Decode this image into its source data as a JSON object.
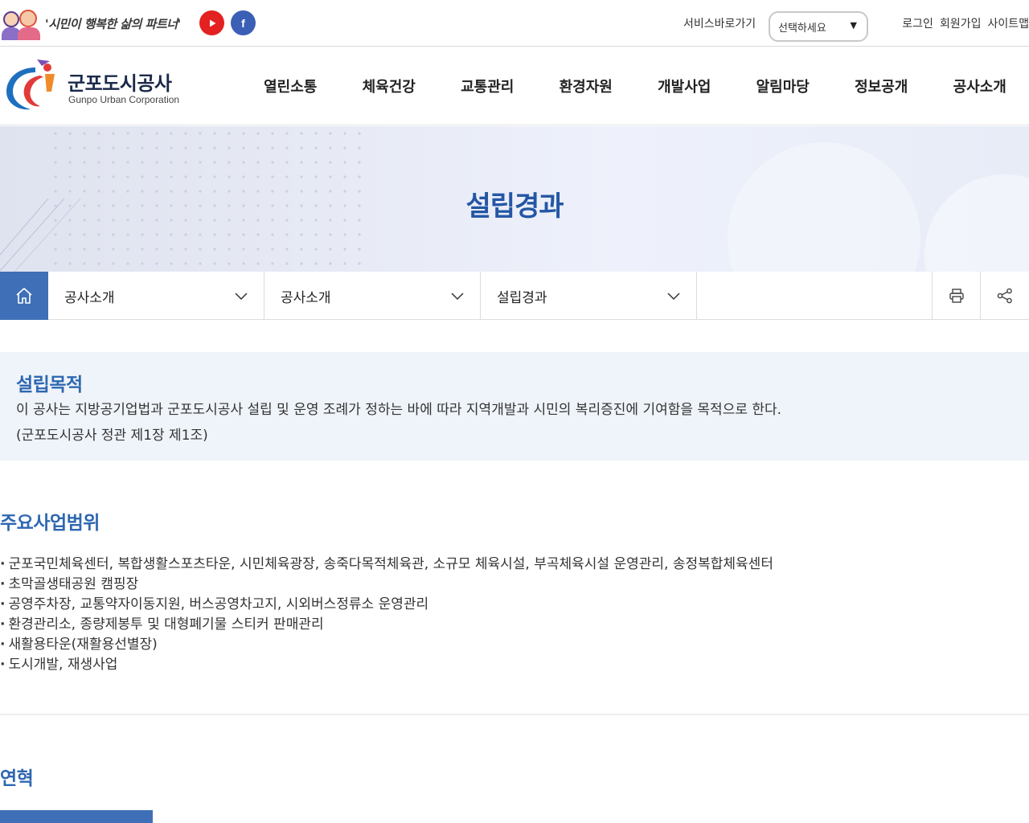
{
  "topbar": {
    "slogan": "'시민이 행복한 삶의 파트너'",
    "sns": {
      "youtube_icon": "youtube-icon",
      "facebook_icon": "facebook-icon",
      "facebook_glyph": "f"
    },
    "shortcut_label": "서비스바로가기",
    "shortcut_select": {
      "selected": "선택하세요"
    },
    "links": [
      "로그인",
      "회원가입",
      "사이트맵"
    ]
  },
  "header": {
    "logo_name": "군포도시공사",
    "logo_sub": "Gunpo Urban Corporation",
    "gnb": [
      "열린소통",
      "체육건강",
      "교통관리",
      "환경자원",
      "개발사업",
      "알림마당",
      "정보공개",
      "공사소개"
    ]
  },
  "visual": {
    "title": "설립경과"
  },
  "location": {
    "home_icon": "home-icon",
    "crumbs": [
      "공사소개",
      "공사소개",
      "설립경과"
    ],
    "print_icon": "print-icon",
    "share_icon": "share-icon"
  },
  "purpose": {
    "title": "설립목적",
    "text": "이 공사는 지방공기업법과 군포도시공사 설립 및 운영 조례가 정하는 바에 따라 지역개발과 시민의 복리증진에 기여함을 목적으로 한다.",
    "source": "(군포도시공사 정관 제1장 제1조)"
  },
  "business": {
    "title": "주요사업범위",
    "items": [
      "군포국민체육센터, 복합생활스포츠타운, 시민체육광장, 송죽다목적체육관, 소규모 체육시설, 부곡체육시설 운영관리, 송정복합체육센터",
      "초막골생태공원 캠핑장",
      "공영주차장, 교통약자이동지원, 버스공영차고지, 시외버스정류소 운영관리",
      "환경관리소, 종량제봉투 및 대형폐기물 스티커 판매관리",
      "새활용타운(재활용선별장)",
      "도시개발, 재생사업"
    ]
  },
  "history": {
    "title": "연혁"
  },
  "colors": {
    "primary": "#3f6fb7",
    "heading": "#2e67b1",
    "visual_title": "#2456a4",
    "youtube": "#e32121",
    "facebook": "#3b5fb5"
  }
}
